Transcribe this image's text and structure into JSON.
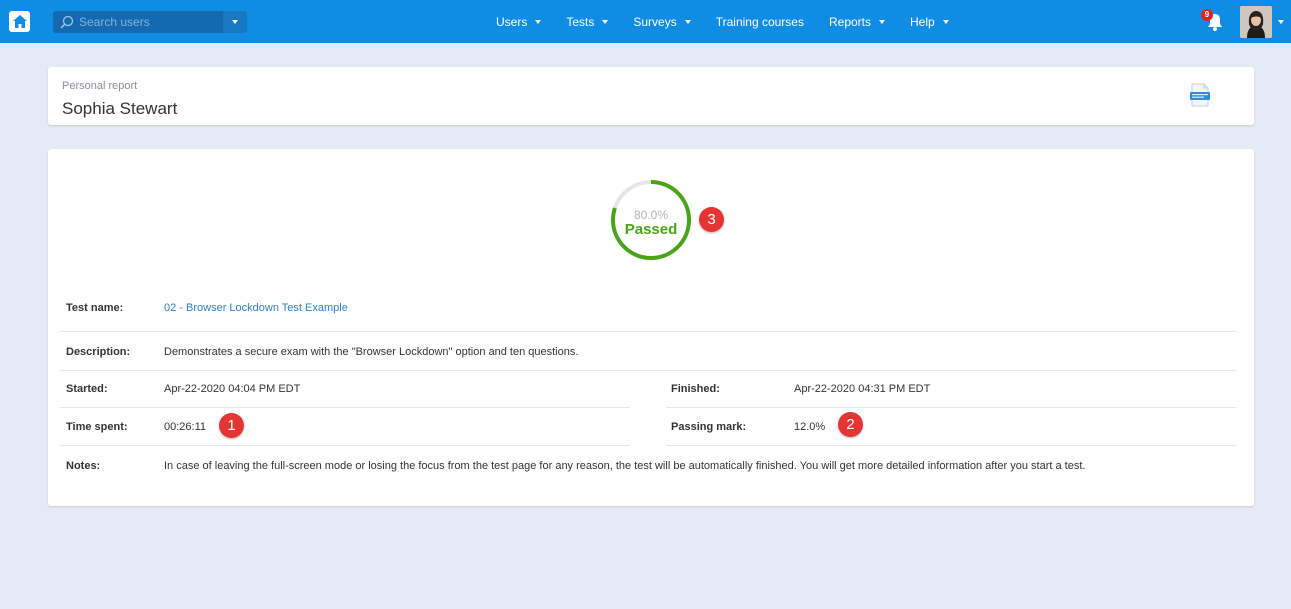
{
  "topbar": {
    "search_placeholder": "Search users",
    "nav": [
      {
        "label": "Users",
        "dropdown": true
      },
      {
        "label": "Tests",
        "dropdown": true
      },
      {
        "label": "Surveys",
        "dropdown": true
      },
      {
        "label": "Training courses",
        "dropdown": false
      },
      {
        "label": "Reports",
        "dropdown": true
      },
      {
        "label": "Help",
        "dropdown": true
      }
    ],
    "notifications_count": "9"
  },
  "header": {
    "subtitle": "Personal report",
    "name": "Sophia Stewart",
    "report_icon": "score-report-icon"
  },
  "result": {
    "percent": "80.0%",
    "score_fraction": 0.8,
    "status": "Passed"
  },
  "details": {
    "test_name_label": "Test name:",
    "test_name": "02 - Browser Lockdown Test Example",
    "description_label": "Description:",
    "description": "Demonstrates a secure exam with the \"Browser Lockdown\" option and ten questions.",
    "started_label": "Started:",
    "started": "Apr-22-2020 04:04 PM EDT",
    "finished_label": "Finished:",
    "finished": "Apr-22-2020 04:31 PM EDT",
    "time_spent_label": "Time spent:",
    "time_spent": "00:26:11",
    "passing_mark_label": "Passing mark:",
    "passing_mark": "12.0%",
    "notes_label": "Notes:",
    "notes": "In case of leaving the full-screen mode or losing the focus from the test page for any reason, the test will be automatically finished. You will get more detailed information after you start a test."
  },
  "markers": [
    "1",
    "2",
    "3"
  ],
  "colors": {
    "topbar": "#0f8de5",
    "passed": "#4aa41b",
    "marker": "#e53434",
    "link": "#2f7fc1"
  }
}
